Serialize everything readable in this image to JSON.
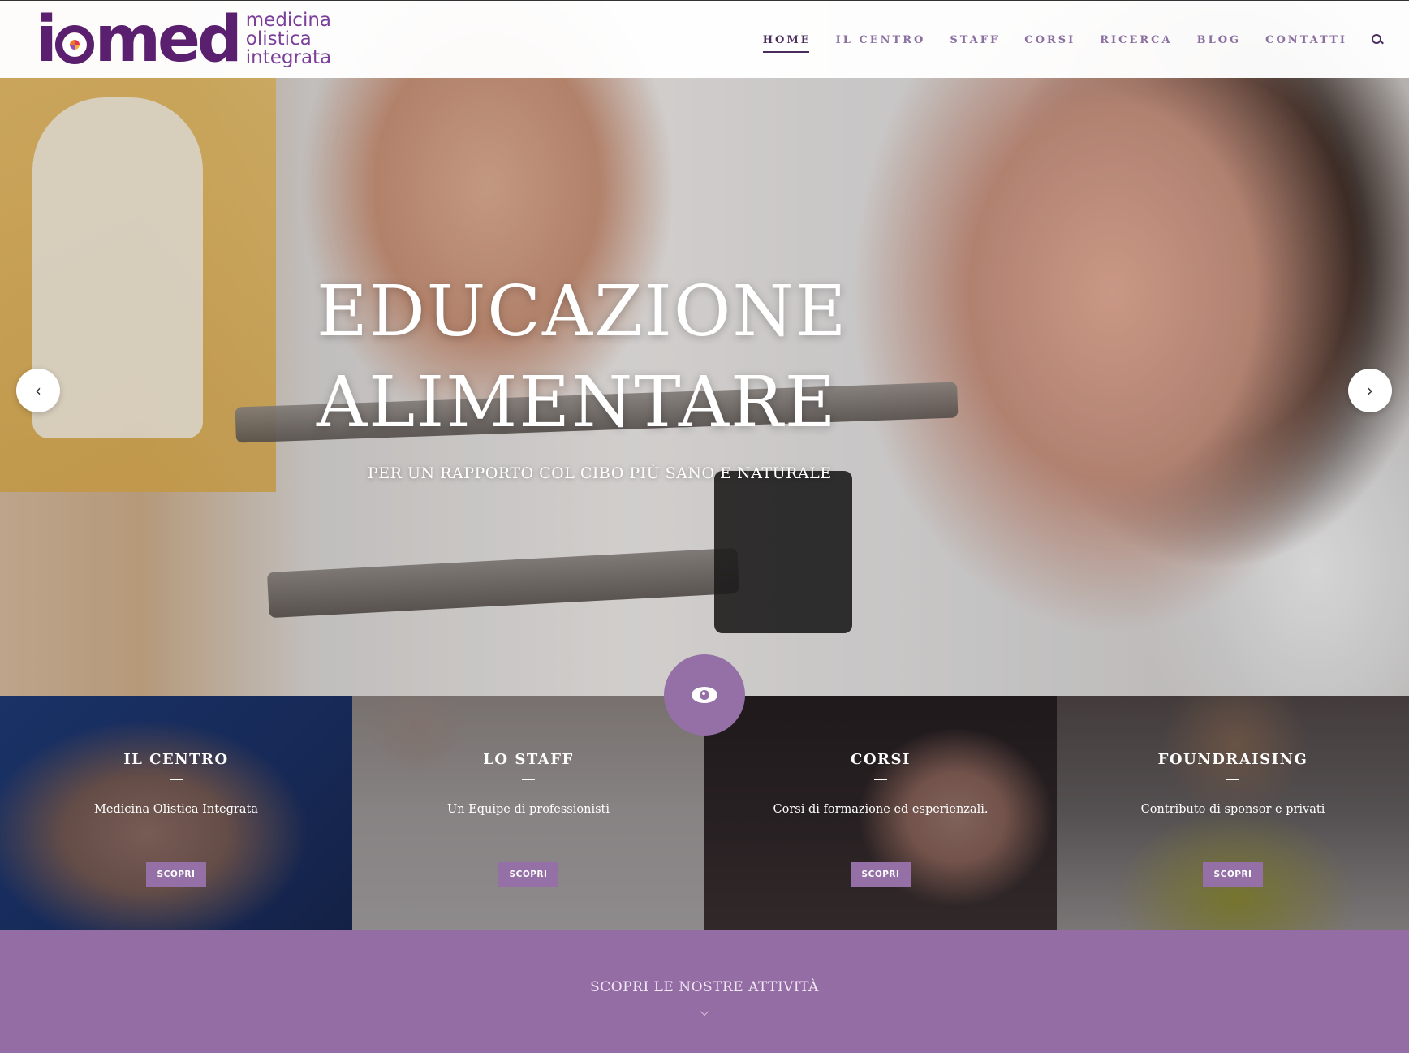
{
  "brand": {
    "logo_mark": "iomed",
    "logo_lines": [
      "medicina",
      "olistica",
      "integrata"
    ]
  },
  "nav": {
    "items": [
      {
        "label": "HOME",
        "active": true
      },
      {
        "label": "IL CENTRO",
        "active": false
      },
      {
        "label": "STAFF",
        "active": false
      },
      {
        "label": "CORSI",
        "active": false
      },
      {
        "label": "RICERCA",
        "active": false
      },
      {
        "label": "BLOG",
        "active": false
      },
      {
        "label": "CONTATTI",
        "active": false
      }
    ],
    "search_icon": "search-icon"
  },
  "hero": {
    "title_line1": "EDUCAZIONE",
    "title_line2": "ALIMENTARE",
    "subtitle": "PER UN RAPPORTO COL CIBO PIÙ SANO E NATURALE",
    "prev_icon": "‹",
    "next_icon": "›"
  },
  "tiles": [
    {
      "title": "IL CENTRO",
      "desc": "Medicina Olistica Integrata",
      "button": "SCOPRI"
    },
    {
      "title": "LO STAFF",
      "desc": "Un Equipe di professionisti",
      "button": "SCOPRI"
    },
    {
      "title": "CORSI",
      "desc": "Corsi di formazione ed esperienzali.",
      "button": "SCOPRI"
    },
    {
      "title": "FOUNDRAISING",
      "desc": "Contributo di sponsor e privati",
      "button": "SCOPRI"
    }
  ],
  "band": {
    "text": "SCOPRI LE NOSTRE ATTIVITÀ"
  },
  "colors": {
    "accent": "#956da5",
    "nav_active": "#4a2d5e",
    "logo": "#5a1f6e"
  }
}
